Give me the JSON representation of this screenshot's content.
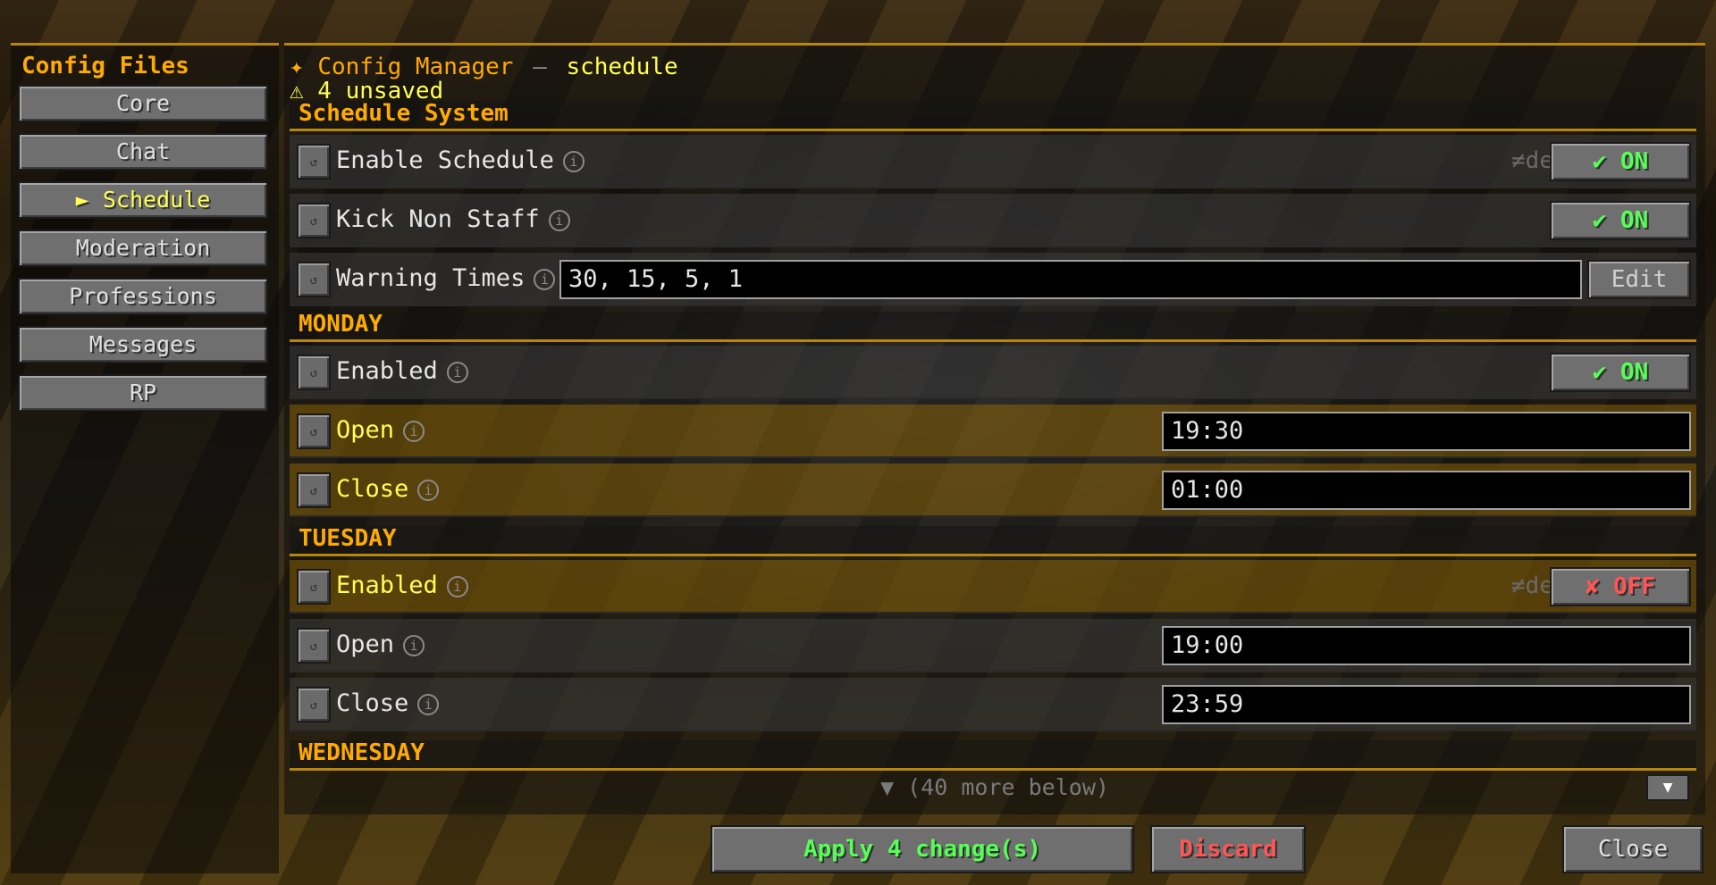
{
  "sidebar": {
    "title": "Config Files",
    "items": [
      {
        "label": "Core"
      },
      {
        "label": "Chat"
      },
      {
        "label": "► Schedule"
      },
      {
        "label": "Moderation"
      },
      {
        "label": "Professions"
      },
      {
        "label": "Messages"
      },
      {
        "label": "RP"
      }
    ],
    "active_item": "Schedule"
  },
  "header": {
    "icon": "✦",
    "title": "Config Manager",
    "separator": "—",
    "file": "schedule",
    "unsaved_text": "⚠ 4 unsaved"
  },
  "sections": {
    "schedule_system": "Schedule System",
    "monday": "MONDAY",
    "tuesday": "TUESDAY",
    "wednesday": "WEDNESDAY"
  },
  "rows": {
    "enable_schedule": {
      "label": "Enable Schedule",
      "default_hint": "≠de",
      "toggle": "✔ ON"
    },
    "kick_non_staff": {
      "label": "Kick Non Staff",
      "toggle": "✔ ON"
    },
    "warning_times": {
      "label": "Warning Times",
      "value": "30, 15, 5, 1",
      "edit_label": "Edit"
    },
    "monday_enabled": {
      "label": "Enabled",
      "toggle": "✔ ON"
    },
    "monday_open": {
      "label": "Open",
      "value": "19:30"
    },
    "monday_close": {
      "label": "Close",
      "value": "01:00"
    },
    "tuesday_enabled": {
      "label": "Enabled",
      "default_hint": "≠de",
      "toggle": "✘ OFF"
    },
    "tuesday_open": {
      "label": "Open",
      "value": "19:00"
    },
    "tuesday_close": {
      "label": "Close",
      "value": "23:59"
    }
  },
  "icons": {
    "info": "i",
    "reset": "↺"
  },
  "scroll": {
    "more_text": "▼ (40 more below)",
    "button": "▼"
  },
  "footer": {
    "apply_label": "Apply 4 change(s)",
    "discard_label": "Discard",
    "close_label": "Close"
  },
  "colors": {
    "accent": "#ffaa00",
    "changed": "#ffff55",
    "on": "#55ff55",
    "off": "#ff5555"
  }
}
